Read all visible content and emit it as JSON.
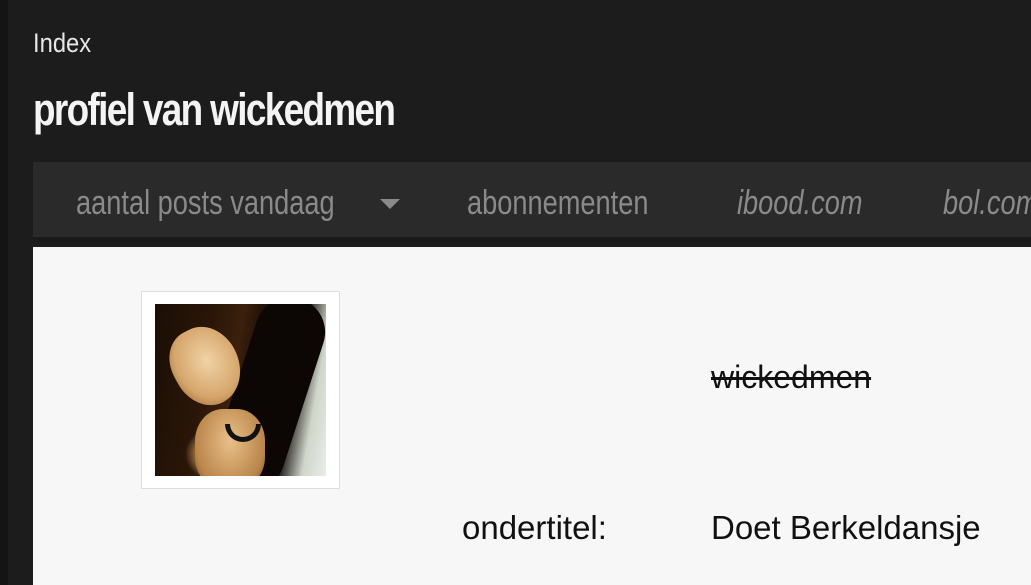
{
  "header": {
    "breadcrumb": "Index",
    "title": "profiel van wickedmen"
  },
  "nav": {
    "items": [
      {
        "label": "aantal posts vandaag",
        "icon": "caret-down-icon"
      },
      {
        "label": "abonnementen"
      },
      {
        "label": "ibood.com"
      },
      {
        "label": "bol.com"
      }
    ]
  },
  "profile": {
    "username": "wickedmen",
    "fields": [
      {
        "label": "ondertitel:",
        "value": "Doet Berkeldansje"
      }
    ]
  },
  "colors": {
    "page_bg": "#1c1c1c",
    "nav_bg": "#2a2a2a",
    "nav_text": "#8a8a8a",
    "content_bg": "#f7f7f7"
  }
}
